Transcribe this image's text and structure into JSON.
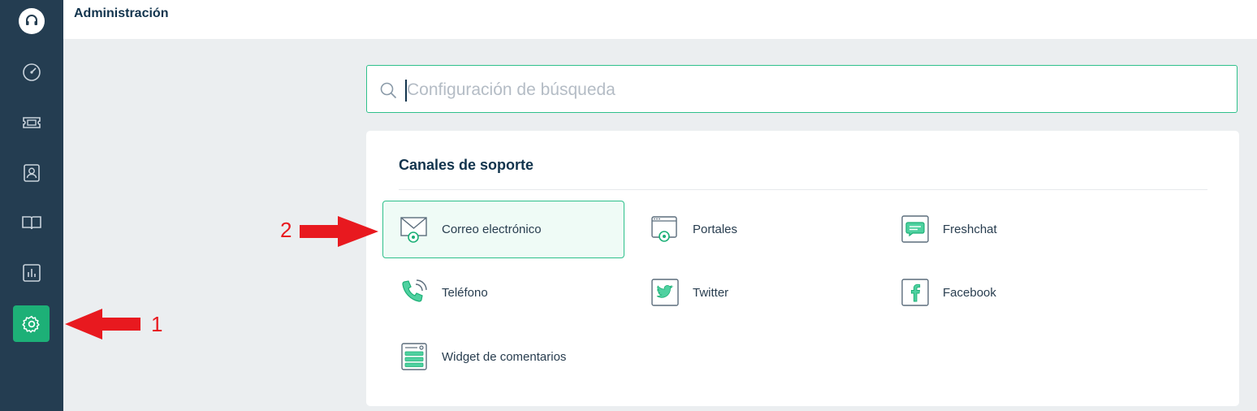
{
  "header": {
    "title": "Administración"
  },
  "search": {
    "placeholder": "Configuración de búsqueda",
    "value": ""
  },
  "sidebar": {
    "items": [
      {
        "icon": "headset-logo-icon"
      },
      {
        "icon": "dashboard-gauge-icon"
      },
      {
        "icon": "tickets-icon"
      },
      {
        "icon": "contacts-icon"
      },
      {
        "icon": "knowledge-book-icon"
      },
      {
        "icon": "reports-icon"
      },
      {
        "icon": "gear-icon",
        "active": true
      }
    ]
  },
  "section": {
    "title": "Canales de soporte",
    "items": [
      {
        "label": "Correo electrónico",
        "icon": "email-gear-icon",
        "selected": true
      },
      {
        "label": "Portales",
        "icon": "portal-icon"
      },
      {
        "label": "Freshchat",
        "icon": "chat-icon"
      },
      {
        "label": "Teléfono",
        "icon": "phone-icon"
      },
      {
        "label": "Twitter",
        "icon": "twitter-icon"
      },
      {
        "label": "Facebook",
        "icon": "facebook-icon"
      },
      {
        "label": "Widget de comentarios",
        "icon": "feedback-widget-icon"
      }
    ]
  },
  "annotations": [
    {
      "label": "1"
    },
    {
      "label": "2"
    }
  ],
  "colors": {
    "sidebar": "#243d51",
    "accent": "#1db077",
    "annotation": "#e8191f"
  }
}
